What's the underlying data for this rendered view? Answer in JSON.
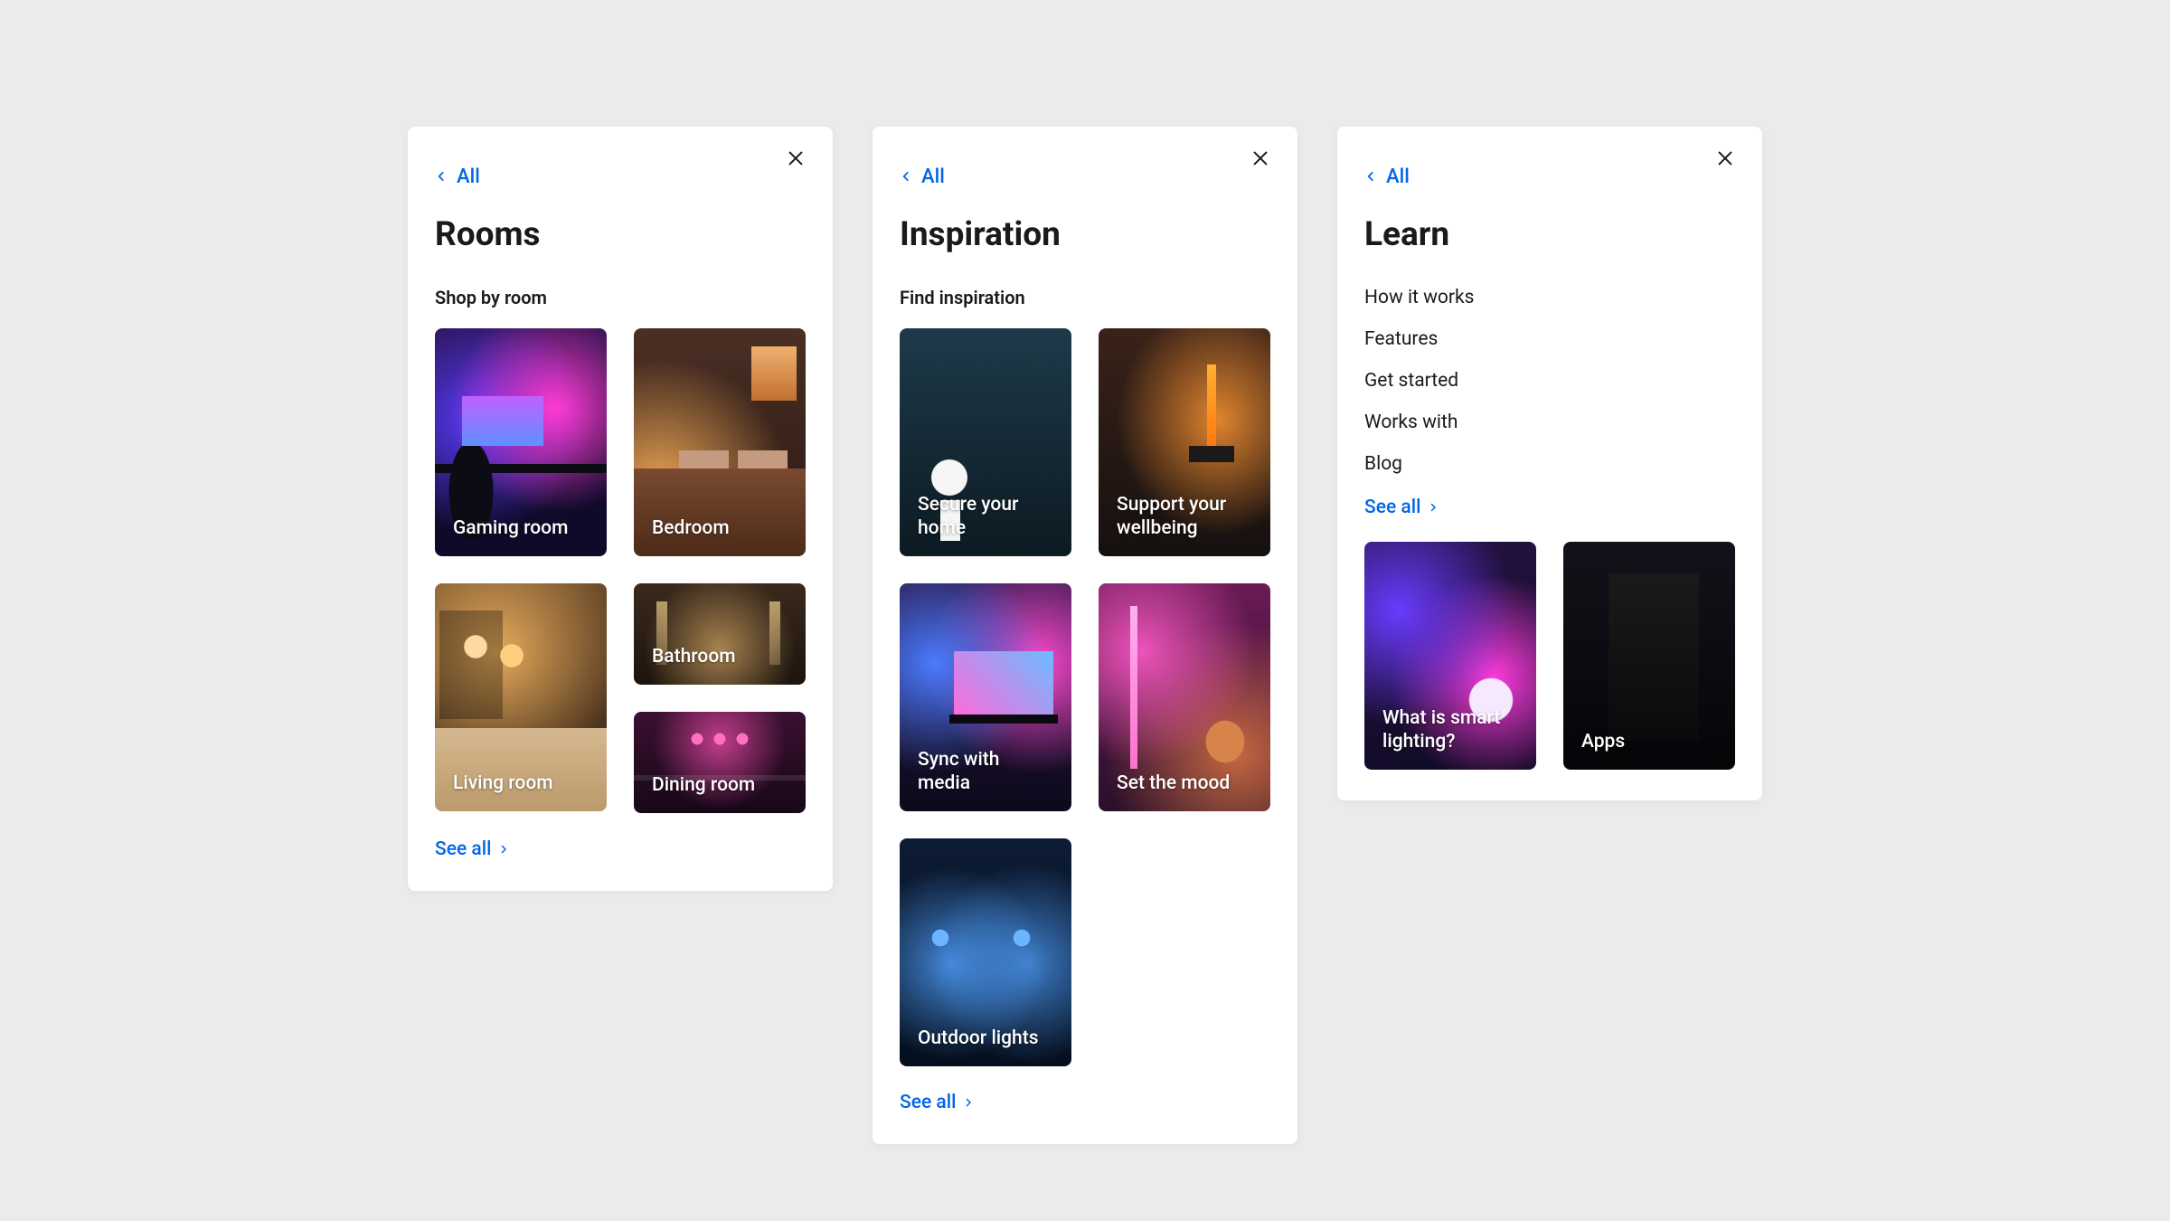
{
  "back_label": "All",
  "see_all_label": "See all",
  "panels": {
    "rooms": {
      "title": "Rooms",
      "section": "Shop by room",
      "tiles": {
        "gaming": "Gaming room",
        "bedroom": "Bedroom",
        "living": "Living room",
        "bathroom": "Bathroom",
        "dining": "Dining room"
      }
    },
    "inspiration": {
      "title": "Inspiration",
      "section": "Find inspiration",
      "tiles": {
        "secure": "Secure your home",
        "wellbeing": "Support your wellbeing",
        "sync": "Sync with media",
        "mood": "Set the mood",
        "outdoor": "Outdoor lights"
      }
    },
    "learn": {
      "title": "Learn",
      "links": {
        "how": "How it works",
        "features": "Features",
        "start": "Get started",
        "works": "Works with",
        "blog": "Blog"
      },
      "tiles": {
        "whatis": "What is smart lighting?",
        "apps": "Apps"
      }
    }
  }
}
